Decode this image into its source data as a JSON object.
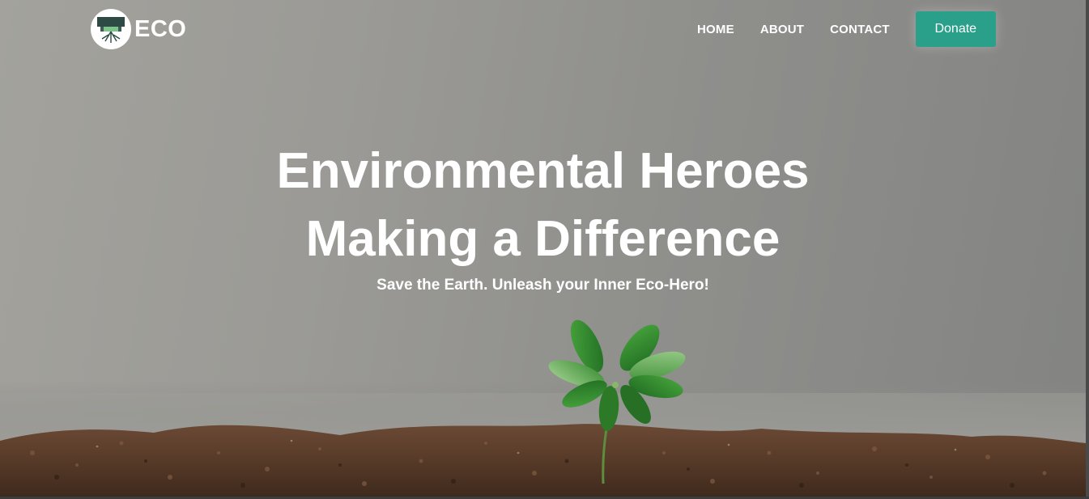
{
  "brand": {
    "name": "ECO",
    "logo_icon": "tree-roots-logo-icon"
  },
  "nav": {
    "links": [
      {
        "label": "HOME"
      },
      {
        "label": "ABOUT"
      },
      {
        "label": "CONTACT"
      }
    ],
    "donate_label": "Donate"
  },
  "hero": {
    "headline_line1": "Environmental Heroes",
    "headline_line2": "Making a Difference",
    "tagline": "Save the Earth. Unleash your Inner Eco-Hero!",
    "image": "seedling-in-soil"
  },
  "colors": {
    "accent": "#2aa08a",
    "background": "#9a9a96",
    "soil": "#5a3d2b",
    "leaf": "#2f8a2c",
    "text": "#ffffff"
  }
}
